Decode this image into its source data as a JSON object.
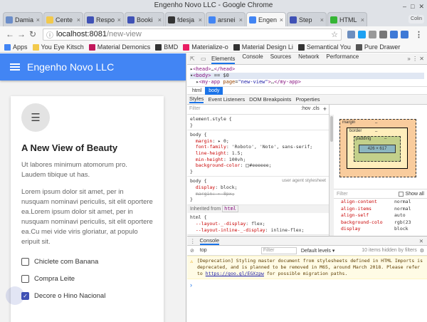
{
  "window": {
    "title": "Engenho Novo LLC - Google Chrome"
  },
  "tabs": [
    {
      "label": "Damia",
      "color": "#6b8dc9"
    },
    {
      "label": "Cente",
      "color": "#f2c94c"
    },
    {
      "label": "Respo",
      "color": "#3f51b5"
    },
    {
      "label": "Booki",
      "color": "#3f51b5"
    },
    {
      "label": "fdesja",
      "color": "#333333"
    },
    {
      "label": "arsnei",
      "color": "#4285f4"
    },
    {
      "label": "Engen",
      "color": "#4285f4",
      "active": true
    },
    {
      "label": "Step",
      "color": "#3f51b5"
    },
    {
      "label": "HTML",
      "color": "#35b535"
    }
  ],
  "profile": "Colin",
  "address": {
    "host": "localhost:8081",
    "path": "/new-view"
  },
  "bookmarks": [
    {
      "label": "Apps",
      "color": "#4285f4"
    },
    {
      "label": "You Eye Kitsch",
      "color": "#f2c94c"
    },
    {
      "label": "Material Demonics",
      "color": "#c2185b"
    },
    {
      "label": "BMD",
      "color": "#333333"
    },
    {
      "label": "Materialize-o",
      "color": "#e91e63"
    },
    {
      "label": "Material Design Li",
      "color": "#333333"
    },
    {
      "label": "Semantical You",
      "color": "#333333"
    },
    {
      "label": "Pure Drawer",
      "color": "#555555"
    }
  ],
  "app": {
    "title": "Engenho Novo LLC",
    "card_title": "A New View of Beauty",
    "para1": "Ut labores minimum atomorum pro. Laudem tibique ut has.",
    "para2": "Lorem ipsum dolor sit amet, per in nusquam nominavi periculis, sit elit oportere ea.Lorem ipsum dolor sit amet, per in nusquam nominavi periculis, sit elit oportere ea.Cu mei vide viris gloriatur, at populo eripuit sit.",
    "checkboxes": [
      {
        "label": "Chiclete com Banana",
        "checked": false
      },
      {
        "label": "Compra Leite",
        "checked": false
      },
      {
        "label": "Decore o Hino Nacional",
        "checked": true
      }
    ]
  },
  "devtools": {
    "tabs": [
      "Elements",
      "Console",
      "Sources",
      "Network",
      "Performance"
    ],
    "crumbs": [
      "html",
      "body"
    ],
    "subtabs": [
      "Styles",
      "Event Listeners",
      "DOM Breakpoints",
      "Properties"
    ],
    "filter_placeholder": "Filter",
    "hov": ":hov .cls",
    "inherited_from": "Inherited from",
    "user_agent": "user agent stylesheet",
    "box": {
      "margin": "margin",
      "border": "border",
      "padding": "padding",
      "content": "426 × 617",
      "dash": "–"
    },
    "computed_filter": "Filter",
    "show_all": "Show all",
    "computed": [
      {
        "prop": "align-content",
        "val": "normal"
      },
      {
        "prop": "align-items",
        "val": "normal"
      },
      {
        "prop": "align-self",
        "val": "auto"
      },
      {
        "prop": "background-colo",
        "val": "rgb(23"
      },
      {
        "prop": "display",
        "val": "block"
      }
    ],
    "console_tab": "Console",
    "context": "top",
    "console_filter": "Filter",
    "levels": "Default levels",
    "hidden": "10 items hidden by filters",
    "warning_pre": "[Deprecation] Styling master document from stylesheets defined in HTML Imports is deprecated, and is planned to be removed in M65, around March 2018. Please refer to ",
    "warning_link": "https://goo.gl/EGXzpw",
    "warning_post": " for possible migration paths."
  }
}
